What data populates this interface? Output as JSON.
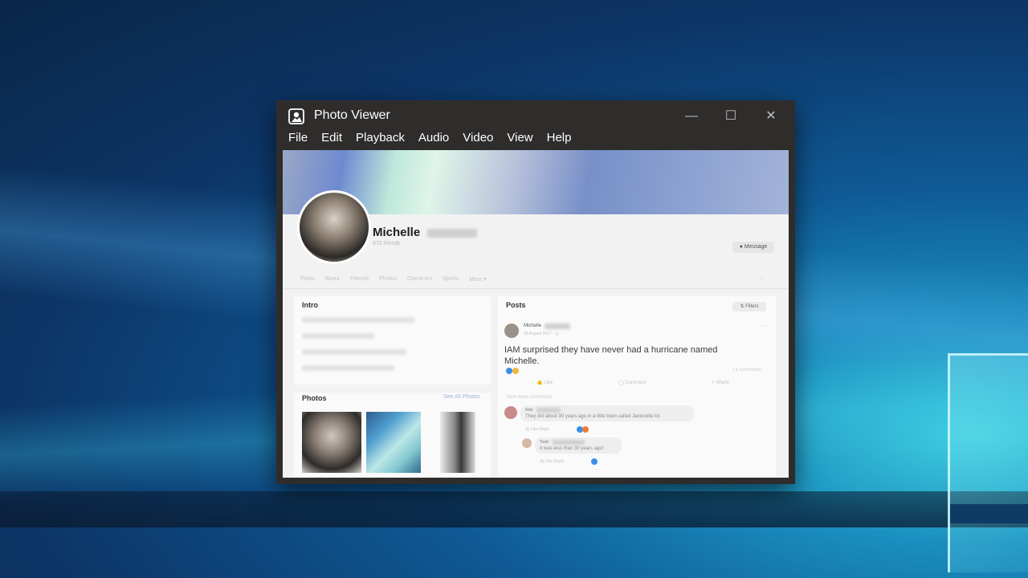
{
  "window": {
    "title": "Photo Viewer",
    "controls": {
      "minimize": "—",
      "maximize": "☐",
      "close": "✕"
    }
  },
  "menu": [
    "File",
    "Edit",
    "Playback",
    "Audio",
    "Video",
    "View",
    "Help"
  ],
  "profile": {
    "name": "Michelle",
    "friends": "872 friends",
    "message_button": "Message",
    "tabs": [
      "Posts",
      "About",
      "Friends",
      "Photos",
      "Check-ins",
      "Sports",
      "More ▾"
    ],
    "tabs_more": "···"
  },
  "intro": {
    "title": "Intro"
  },
  "photos": {
    "title": "Photos",
    "see_all": "See All Photos"
  },
  "posts": {
    "title": "Posts",
    "filters": "⇅ Filters",
    "post": {
      "author": "Michelle",
      "date": "26 August 2017 · ◎",
      "text": "IAM surprised they have never had a hurricane named Michelle.",
      "menu": "···",
      "comments_count": "14 comments",
      "actions": {
        "like": "Like",
        "comment": "Comment",
        "share": "Share"
      },
      "view_more": "View more comments"
    },
    "comments": [
      {
        "name": "Nick",
        "text": "They did about 30 years ago in a little town called Janesville lol",
        "meta": "3y   Like   Reply"
      },
      {
        "name": "Todd",
        "text": "It was less than 30 years ago!",
        "meta": "3y   Like   Reply"
      }
    ]
  }
}
